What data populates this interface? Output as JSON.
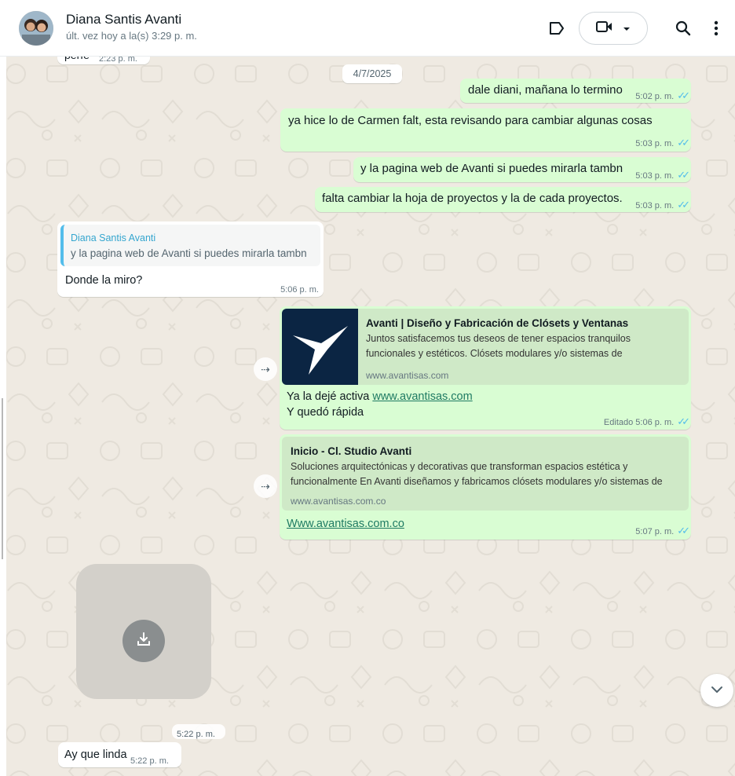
{
  "header": {
    "contact_name": "Diana Santis Avanti",
    "contact_status": "últ. vez hoy a la(s) 3:29 p. m.",
    "icons": [
      "label-icon",
      "video-call-icon",
      "chevron-down-icon",
      "search-icon",
      "menu-icon"
    ]
  },
  "chat": {
    "prev_partial_text": "perfe",
    "prev_time": "2:23 p. m.",
    "date_chip": "4/7/2025",
    "messages": [
      {
        "text": "dale diani, mañana lo termino",
        "time": "5:02 p. m."
      },
      {
        "text": "ya hice lo de Carmen falt, esta revisando para cambiar algunas cosas",
        "time": "5:03 p. m."
      },
      {
        "text": "y la pagina web de Avanti si puedes mirarla tambn",
        "time": "5:03 p. m."
      },
      {
        "text": "falta cambiar la hoja de proyectos y la de cada proyectos.",
        "time": "5:03 p. m."
      }
    ],
    "reply": {
      "quoted_author": "Diana Santis Avanti",
      "quoted_text": "y la pagina web de Avanti si puedes mirarla tambn",
      "text": "Donde la miro?",
      "time": "5:06 p. m."
    },
    "link1": {
      "title": "Avanti | Diseño y Fabricación de Clósets y Ventanas",
      "desc1": "Juntos satisfacemos tus deseos de tener espacios tranquilos",
      "desc2": "funcionales y estéticos. Clósets modulares y/o sistemas de",
      "url": "www.avantisas.com",
      "text_prefix": "Ya la dejé activa ",
      "link_text": "www.avantisas.com",
      "text_line2": "Y quedó rápida",
      "time": "Editado 5:06 p. m."
    },
    "link2": {
      "title": "Inicio - Cl. Studio Avanti",
      "desc1": "Soluciones arquitectónicas y decorativas que transforman espacios estética y",
      "desc2": "funcionalmente En Avanti diseñamos y fabricamos clósets modulares y/o sistemas de",
      "url": "www.avantisas.com.co",
      "link_text": "Www.avantisas.com.co",
      "time": "5:07 p. m."
    },
    "media_time": "5:22 p. m.",
    "last": {
      "text": "Ay que linda",
      "time": "5:22 p. m."
    }
  },
  "colors": {
    "outgoing_bubble": "#d9fdd3",
    "incoming_bubble": "#ffffff",
    "wallpaper": "#efeae2",
    "read_tick": "#53bdeb",
    "quote_bar": "#53bdeb"
  }
}
